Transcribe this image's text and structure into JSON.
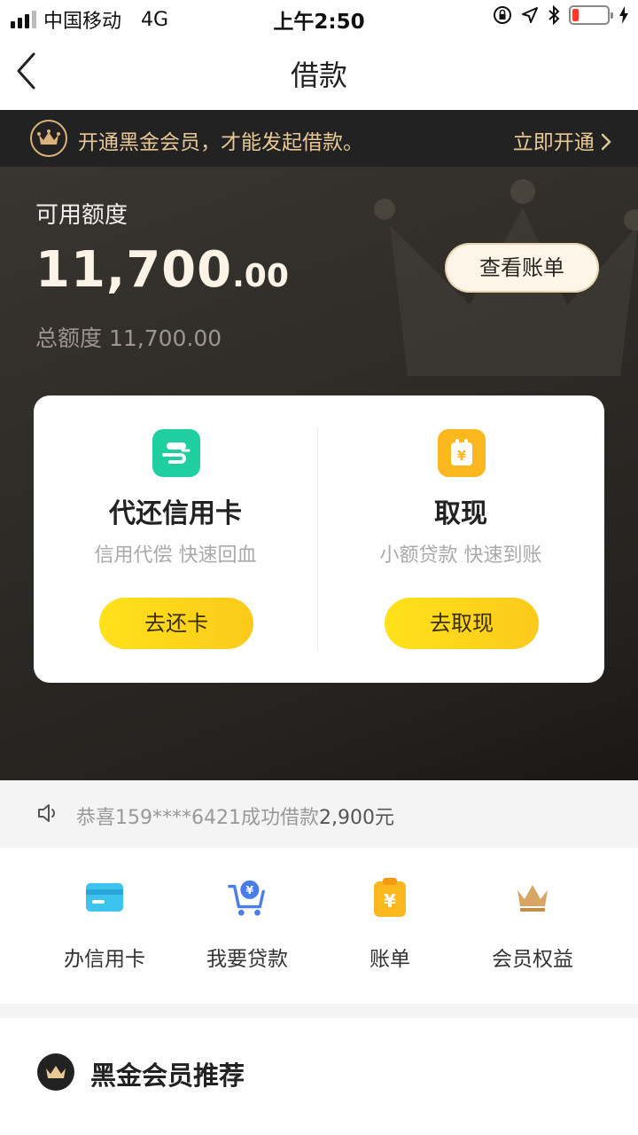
{
  "status_bar": {
    "carrier": "中国移动",
    "network": "4G",
    "time": "上午2:50",
    "battery_level": 0.18,
    "battery_color": "#ff3b30"
  },
  "nav": {
    "title": "借款",
    "back_icon": "chevron-left-icon"
  },
  "member_banner": {
    "text": "开通黑金会员，才能发起借款。",
    "link_label": "立即开通 ",
    "accent_color": "#e7c896"
  },
  "credit": {
    "label": "可用额度",
    "amount_int": "11,700",
    "amount_dec": ".00",
    "total_label": "总额度 11,700.00",
    "bill_button": "查看账单"
  },
  "services": [
    {
      "icon": "repay-card-icon",
      "icon_color": "#1fcf9f",
      "title": "代还信用卡",
      "subtitle": "信用代偿 快速回血",
      "button": "去还卡"
    },
    {
      "icon": "cash-withdraw-icon",
      "icon_color": "#fbb71e",
      "title": "取现",
      "subtitle": "小额贷款 快速到账",
      "button": "去取现"
    }
  ],
  "notice": {
    "icon": "speaker-icon",
    "text": "恭喜159****6421成功借款",
    "amount": "2,900元"
  },
  "quick_menu": [
    {
      "icon": "credit-card-icon",
      "label": "办信用卡"
    },
    {
      "icon": "loan-cart-icon",
      "label": "我要贷款"
    },
    {
      "icon": "bill-clipboard-icon",
      "label": "账单"
    },
    {
      "icon": "crown-icon",
      "label": "会员权益"
    }
  ],
  "recommend": {
    "title": "黑金会员推荐"
  }
}
